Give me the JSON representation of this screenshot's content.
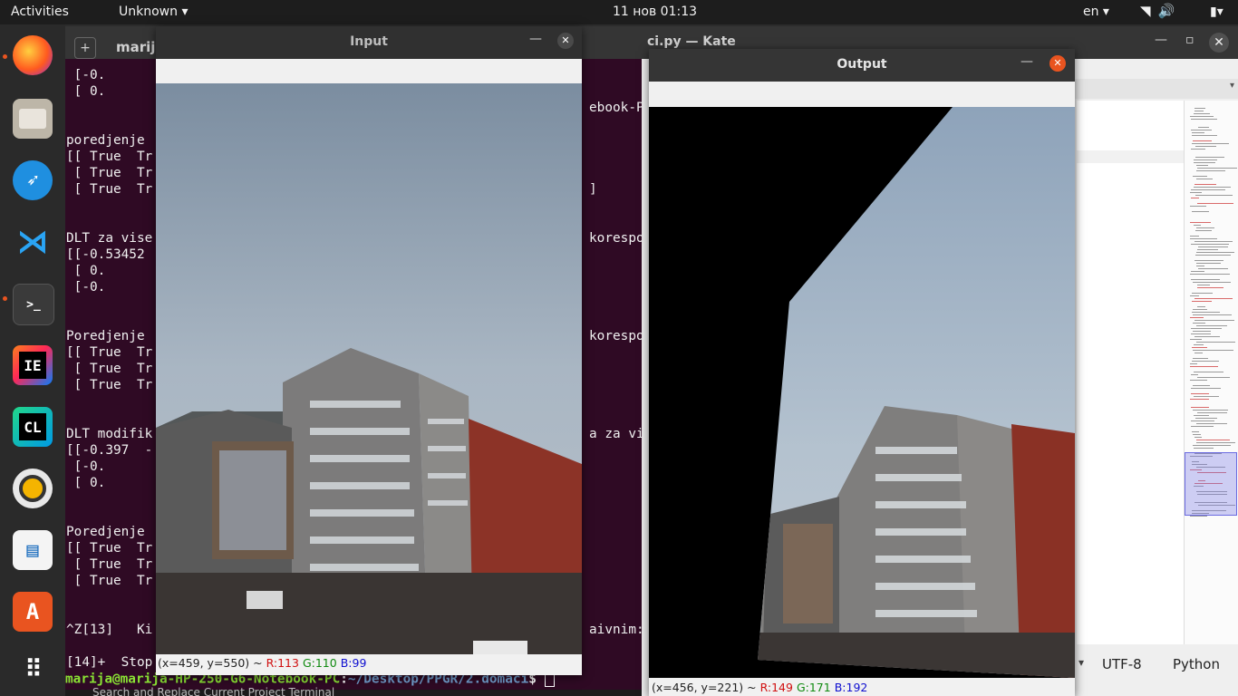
{
  "topbar": {
    "activities": "Activities",
    "app_menu": "Unknown ▾",
    "clock": "11 нов  01:13",
    "language": "en ▾"
  },
  "dock": {
    "items": [
      "firefox-icon",
      "files-icon",
      "kite-icon",
      "vscode-icon",
      "terminal-icon",
      "intellij-icon",
      "clion-icon",
      "rhythmbox-icon",
      "libreoffice-impress-icon",
      "software-center-icon",
      "show-apps-icon"
    ]
  },
  "terminal": {
    "title": "marija",
    "lines": [
      " [-0.",
      " [ 0.",
      "",
      "",
      "poredjenje",
      "[[ True  Tr",
      " [ True  Tr",
      " [ True  Tr",
      "",
      "",
      "DLT za vise",
      "[[-0.53452",
      " [ 0.",
      " [-0.",
      "",
      "",
      "Poredjenje",
      "[[ True  Tr",
      " [ True  Tr",
      " [ True  Tr",
      "",
      "",
      "DLT modifik",
      "[[-0.397  -",
      " [-0.      ",
      " [ 0.",
      "",
      "",
      "Poredjenje",
      "[[ True  Tr",
      " [ True  Tr",
      " [ True  Tr",
      "",
      "",
      "^Z[13]   Ki",
      "",
      "[14]+  Stop"
    ],
    "right_fragments": [
      {
        "row": 3,
        "text": "ebook-PC:"
      },
      {
        "row": 8,
        "text": "]"
      },
      {
        "row": 11,
        "text": "korespo"
      },
      {
        "row": 17,
        "text": "korespo"
      },
      {
        "row": 23,
        "text": "a za vis"
      },
      {
        "row": 35,
        "text": "aivnim:"
      }
    ],
    "prompt_user": "marija@marija-HP-250-G6-Notebook-PC",
    "prompt_path": "~/Desktop/PPGR/2.domaci",
    "prompt_symbol": "$ ",
    "bottom_text": "Search and Replace   Current Project   Terminal"
  },
  "kate": {
    "title": "ci.py  — Kate",
    "encoding": "UTF-8",
    "language": "Python"
  },
  "input_window": {
    "title": "Input",
    "status": "(x=459, y=550) ~ ",
    "r": "R:113",
    "g": "G:110",
    "b": "B:99"
  },
  "output_window": {
    "title": "Output",
    "status": "(x=456, y=221) ~ ",
    "r": "R:149",
    "g": "G:171",
    "b": "B:192"
  },
  "colors": {
    "terminal_bg": "#2f0a24",
    "ubuntu_orange": "#e95420",
    "prompt_green": "#8ae234",
    "prompt_blue": "#729fcf"
  }
}
